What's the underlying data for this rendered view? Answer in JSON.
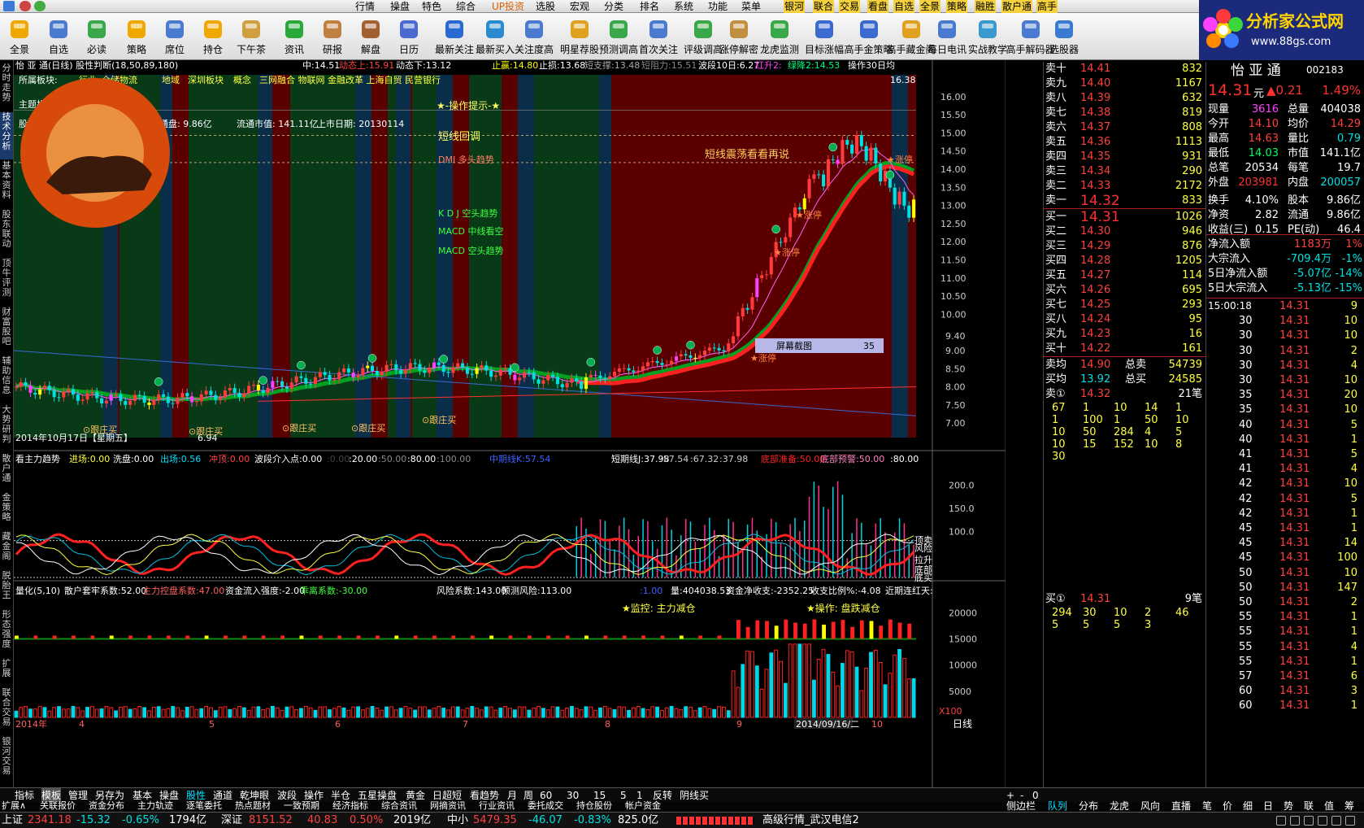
{
  "menu": {
    "items": [
      "行情",
      "操盘",
      "特色",
      "综合",
      "UP投资",
      "选股",
      "宏观",
      "分类",
      "排名",
      "系统",
      "功能",
      "菜单"
    ],
    "buttons": [
      "银河",
      "联合",
      "交易",
      "看盘",
      "自选",
      "全景",
      "策略",
      "融胜",
      "散户通",
      "高手"
    ]
  },
  "toolbar": {
    "items": [
      "全景",
      "自选",
      "必读",
      "策略",
      "席位",
      "持仓",
      "下午茶",
      "资讯",
      "研报",
      "解盘",
      "日历",
      "最新关注",
      "最新买入",
      "关注度高",
      "明星荐股",
      "预测调高",
      "首次关注",
      "评级调高",
      "涨停解密",
      "龙虎监测",
      "目标涨幅",
      "高手金策略",
      "高手藏金阁",
      "每日电讯",
      "实战教学",
      "高手解码器",
      "选股器"
    ]
  },
  "logo": {
    "title": "分析家公式网",
    "url": "www.88gs.com"
  },
  "left_tabs": [
    "分时走势",
    "技术分析",
    "基本资料",
    "股东联动",
    "顶牛评测",
    "财富股吧",
    "辅助信息",
    "大势研判",
    "散户通",
    "金策略",
    "藏金阁",
    "脱胎王",
    "形态强度",
    "扩展",
    "联合交易",
    "银河交易"
  ],
  "chart_header": {
    "stock": "怡 亚 通(日线) 股性判断(18,50,89,180)",
    "mid": "中:14.51",
    "dyn_up": "动态上:15.91",
    "dyn_down": "动态下:13.12",
    "stop_profit": "止赢:14.80",
    "stop_loss": "止损:13.68",
    "short_support": "短支撑:13.48",
    "short_resist": "短阻力:15.51",
    "wave": "波段10日:6.27",
    "red_up": "红升2:",
    "green_down": "绿降2:14.53",
    "op": "操作30日均"
  },
  "info": {
    "sector_label": "所属板块:",
    "sectors": [
      "行业",
      "仓储物流",
      "地域",
      "深圳板块",
      "概念",
      "三网融合 物联网 金融改革 上海自贸 民营银行"
    ],
    "theme_label": "主题投资:",
    "eps": "股本市值:",
    "total_shares": "总股本:9.86亿",
    "float_shares": "流通盘:  9.86亿",
    "float_mv": "流通市值:  141.11亿",
    "list_date": "上市日期: 20130114"
  },
  "annotations": {
    "op_tip": "★-操作提示-★",
    "short_pullback": "短线回调",
    "dmi": "DMI 多头趋势",
    "kdj": "K D J 空头趋势",
    "macd_mid": "MACD 中线看空",
    "macd_short": "MACD 空头趋势",
    "oscillate": "短线震荡看看再说",
    "peak": "16.38",
    "low": "6.94",
    "date": "2014年10月17日【星期五】",
    "zt": "涨停",
    "follow": "跟庄买",
    "rlabels": [
      "短阻力",
      "止赢",
      "止损",
      "短支撑"
    ],
    "screenshot": "屏幕截图",
    "screenshot_n": "35"
  },
  "price_axis": [
    "16.00",
    "15.50",
    "15.00",
    "14.50",
    "14.00",
    "13.50",
    "13.00",
    "12.50",
    "12.00",
    "11.50",
    "11.00",
    "10.50",
    "10.00",
    "9.40",
    "9.00",
    "8.50",
    "8.00",
    "7.50",
    "7.00"
  ],
  "osc_header": {
    "name": "看主力趋势",
    "enter": "进场:0.00",
    "wash": "洗盘:0.00",
    "exit": "出场:0.56",
    "rush": "冲顶:0.00",
    "wave_point": "波段介入点:0.00",
    "v1": ":0.00",
    "v2": ":20.00",
    "v3": ":50.00",
    "v4": ":80.00",
    "v5": ":100.00",
    "mid_k": "中期线K:57.54",
    "short_j": "短期线J:37.98",
    "s1": ":57.54",
    "s2": ":67.32",
    "s3": ":37.98",
    "bottom_prep": "底部准备:50.00",
    "bottom_warn": "底部预警:50.00",
    "v6": ":80.00"
  },
  "osc_axis": [
    "200.0",
    "150.0",
    "100.0"
  ],
  "osc_rlabels": [
    "顶卖",
    "风险",
    "拉升",
    "底部",
    "底买"
  ],
  "vol_header": {
    "name": "量化(5,10)",
    "retail": "散户套牢系数:52.00",
    "main": "主力控盘系数:47.00",
    "inflow": "资金流入强度:-2.00",
    "depart": "乖离系数:-30.00",
    "risk": "风险系数:143.00",
    "predict": "预测风险:113.00",
    "v1": ":1.00",
    "vol": "量:404038.53",
    "net": "资金净收支:-2352.25",
    "ratio": "收支比例%:-4.08",
    "recent": "近期连红天:"
  },
  "vol_tags": {
    "monitor": "★监控: 主力减仓",
    "op": "★操作: 盘跌减仓"
  },
  "vol_axis": [
    "20000",
    "15000",
    "10000",
    "5000",
    "X100"
  ],
  "x_axis": {
    "labels": [
      "2014年",
      "4",
      "5",
      "6",
      "7",
      "8",
      "9",
      "10"
    ],
    "cursor": "2014/09/16/二"
  },
  "period_tabs": [
    "指标",
    "模板",
    "管理",
    "另存为",
    "基本",
    "操盘",
    "股性",
    "通道",
    "乾坤眼",
    "波段",
    "操作",
    "半仓",
    "五星操盘",
    "黄金",
    "日超短",
    "看趋势",
    "月",
    "周",
    "60",
    "30",
    "15",
    "5",
    "1",
    "反转",
    "阴线买"
  ],
  "ext_tabs": [
    "扩展∧",
    "关联报价",
    "资金分布",
    "主力轨迹",
    "逐笔委托",
    "热点题材",
    "一致预期",
    "经济指标",
    "综合资讯",
    "网摘资讯",
    "行业资讯",
    "委托成交",
    "持仓股份",
    "帐户资金"
  ],
  "right_tabs": [
    "侧边栏",
    "队列",
    "分布",
    "龙虎",
    "风向",
    "直播",
    "笔",
    "价",
    "细",
    "日",
    "势",
    "联",
    "值",
    "筹"
  ],
  "orderbook": {
    "sell": [
      [
        "卖十",
        "14.41",
        "832"
      ],
      [
        "卖九",
        "14.40",
        "1167"
      ],
      [
        "卖八",
        "14.39",
        "632"
      ],
      [
        "卖七",
        "14.38",
        "819"
      ],
      [
        "卖六",
        "14.37",
        "808"
      ],
      [
        "卖五",
        "14.36",
        "1113"
      ],
      [
        "卖四",
        "14.35",
        "931"
      ],
      [
        "卖三",
        "14.34",
        "290"
      ],
      [
        "卖二",
        "14.33",
        "2172"
      ],
      [
        "卖一",
        "14.32",
        "833"
      ]
    ],
    "buy": [
      [
        "买一",
        "14.31",
        "1026"
      ],
      [
        "买二",
        "14.30",
        "946"
      ],
      [
        "买三",
        "14.29",
        "876"
      ],
      [
        "买四",
        "14.28",
        "1205"
      ],
      [
        "买五",
        "14.27",
        "114"
      ],
      [
        "买六",
        "14.26",
        "695"
      ],
      [
        "买七",
        "14.25",
        "293"
      ],
      [
        "买八",
        "14.24",
        "95"
      ],
      [
        "买九",
        "14.23",
        "16"
      ],
      [
        "买十",
        "14.22",
        "161"
      ]
    ],
    "sell_avg": "14.90",
    "total_sell": "54739",
    "buy_avg": "13.92",
    "total_buy": "24585",
    "sell1_queue_label": "卖①",
    "sell1_queue_price": "14.32",
    "sell1_queue_count": "21笔",
    "sell_queue": [
      [
        "67",
        "1",
        "10",
        "14",
        "1"
      ],
      [
        "1",
        "100",
        "1",
        "50",
        "10"
      ],
      [
        "10",
        "50",
        "284",
        "4",
        "5"
      ],
      [
        "10",
        "15",
        "152",
        "10",
        "8"
      ],
      [
        "30"
      ]
    ],
    "buy1_queue_label": "买①",
    "buy1_queue_price": "14.31",
    "buy1_queue_count": "9笔",
    "buy_queue": [
      [
        "294",
        "30",
        "10",
        "2",
        "46"
      ],
      [
        "5",
        "5",
        "5",
        "3"
      ]
    ],
    "labels": {
      "sell_avg": "卖均",
      "total_sell": "总卖",
      "buy_avg": "买均",
      "total_buy": "总买"
    }
  },
  "quote": {
    "name": "怡 亚 通",
    "code": "002183",
    "price": "14.31",
    "unit": "元",
    "change": "▲0.21",
    "pct": "1.49%",
    "fields": [
      [
        "现量",
        "3616",
        "总量",
        "404038"
      ],
      [
        "今开",
        "14.10",
        "均价",
        "14.29"
      ],
      [
        "最高",
        "14.63",
        "量比",
        "0.79"
      ],
      [
        "最低",
        "14.03",
        "市值",
        "141.1亿"
      ],
      [
        "总笔",
        "20534",
        "每笔",
        "19.7"
      ],
      [
        "外盘",
        "203981",
        "内盘",
        "200057"
      ],
      [
        "换手",
        "4.10%",
        "股本",
        "9.86亿"
      ],
      [
        "净资",
        "2.82",
        "流通",
        "9.86亿"
      ],
      [
        "收益(三)",
        "0.15",
        "PE(动)",
        "46.4"
      ]
    ],
    "flows": [
      [
        "净流入额",
        "1183万",
        "1%"
      ],
      [
        "大宗流入",
        "-709.4万",
        "-1%"
      ],
      [
        "5日净流入额",
        "-5.07亿",
        "-14%"
      ],
      [
        "5日大宗流入",
        "-5.13亿",
        "-15%"
      ]
    ],
    "ticks_time": "15:00:18",
    "ticks": [
      [
        "",
        "14.31",
        "9"
      ],
      [
        "30",
        "14.31",
        "10"
      ],
      [
        "30",
        "14.31",
        "10"
      ],
      [
        "30",
        "14.31",
        "2"
      ],
      [
        "30",
        "14.31",
        "4"
      ],
      [
        "30",
        "14.31",
        "10"
      ],
      [
        "35",
        "14.31",
        "20"
      ],
      [
        "35",
        "14.31",
        "10"
      ],
      [
        "40",
        "14.31",
        "5"
      ],
      [
        "40",
        "14.31",
        "1"
      ],
      [
        "41",
        "14.31",
        "5"
      ],
      [
        "41",
        "14.31",
        "4"
      ],
      [
        "42",
        "14.31",
        "10"
      ],
      [
        "42",
        "14.31",
        "5"
      ],
      [
        "42",
        "14.31",
        "1"
      ],
      [
        "45",
        "14.31",
        "1"
      ],
      [
        "45",
        "14.31",
        "14"
      ],
      [
        "45",
        "14.31",
        "100"
      ],
      [
        "50",
        "14.31",
        "10"
      ],
      [
        "50",
        "14.31",
        "147"
      ],
      [
        "50",
        "14.31",
        "2"
      ],
      [
        "55",
        "14.31",
        "1"
      ],
      [
        "55",
        "14.31",
        "1"
      ],
      [
        "55",
        "14.31",
        "4"
      ],
      [
        "55",
        "14.31",
        "1"
      ],
      [
        "57",
        "14.31",
        "6"
      ],
      [
        "60",
        "14.31",
        "3"
      ],
      [
        "60",
        "14.31",
        "1"
      ]
    ]
  },
  "status": {
    "sh": "上证",
    "sh_val": "2341.18",
    "sh_chg": "-15.32",
    "sh_pct": "-0.65%",
    "sh_amt": "1794亿",
    "sz": "深证",
    "sz_val": "8151.52",
    "sz_chg": "40.83",
    "sz_pct": "0.50%",
    "sz_amt": "2019亿",
    "zx": "中小",
    "zx_val": "5479.35",
    "zx_chg": "-46.07",
    "zx_pct": "-0.83%",
    "zx_amt": "825.0亿",
    "server": "高级行情_武汉电信2"
  },
  "colors": {
    "up": "#ff3b3b",
    "down": "#00e0e0",
    "yellow": "#ffff00",
    "green": "#00c000",
    "magenta": "#ff40ff",
    "grid": "#7a0000"
  }
}
